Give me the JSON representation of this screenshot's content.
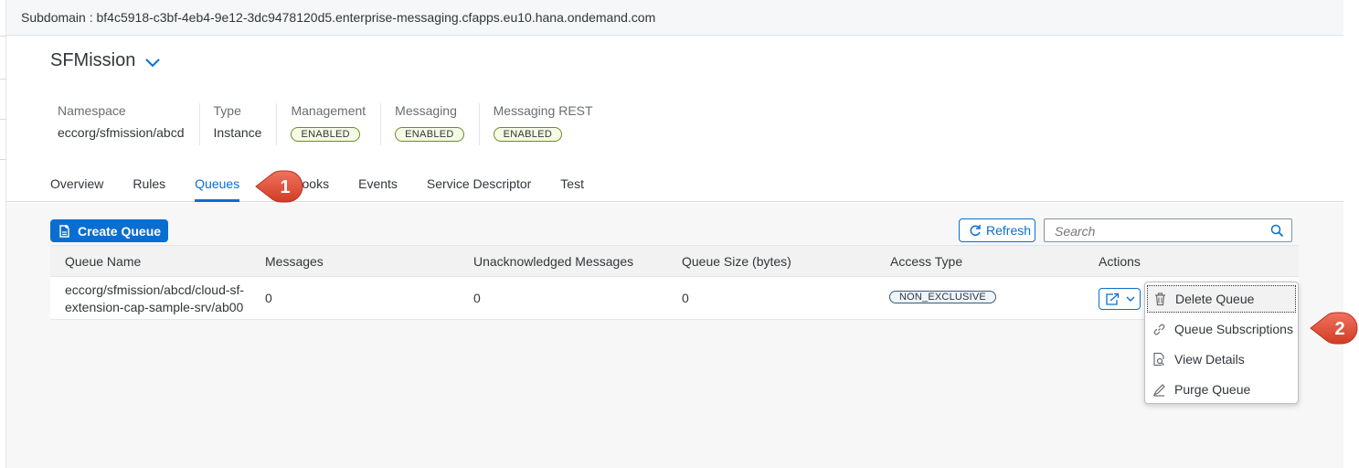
{
  "subdomain": "Subdomain : bf4c5918-c3bf-4eb4-9e12-3dc9478120d5.enterprise-messaging.cfapps.eu10.hana.ondemand.com",
  "header": {
    "title": "SFMission",
    "attributes": [
      {
        "label": "Namespace",
        "value": "eccorg/sfmission/abcd"
      },
      {
        "label": "Type",
        "value": "Instance"
      },
      {
        "label": "Management",
        "badge": "ENABLED"
      },
      {
        "label": "Messaging",
        "badge": "ENABLED"
      },
      {
        "label": "Messaging REST",
        "badge": "ENABLED"
      }
    ],
    "tabs": [
      "Overview",
      "Rules",
      "Queues",
      "Webhooks",
      "Events",
      "Service Descriptor",
      "Test"
    ],
    "active_tab": "Queues"
  },
  "toolbar": {
    "create_label": "Create Queue",
    "refresh_label": "Refresh",
    "search_placeholder": "Search"
  },
  "table": {
    "columns": [
      "Queue Name",
      "Messages",
      "Unacknowledged Messages",
      "Queue Size (bytes)",
      "Access Type",
      "Actions"
    ],
    "rows": [
      {
        "queue_name_line1": "eccorg/sfmission/abcd/cloud-sf-",
        "queue_name_line2": "extension-cap-sample-srv/ab00",
        "messages": "0",
        "unacknowledged": "0",
        "size": "0",
        "access_type": "NON_EXCLUSIVE"
      }
    ]
  },
  "menu": {
    "items": [
      {
        "label": "Delete Queue",
        "icon": "trash-icon"
      },
      {
        "label": "Queue Subscriptions",
        "icon": "link-icon"
      },
      {
        "label": "View Details",
        "icon": "document-search-icon"
      },
      {
        "label": "Purge Queue",
        "icon": "eraser-icon"
      }
    ]
  },
  "callouts": [
    "1",
    "2"
  ],
  "colors": {
    "accent": "#0a6ed1",
    "callout": "#e8503a"
  }
}
